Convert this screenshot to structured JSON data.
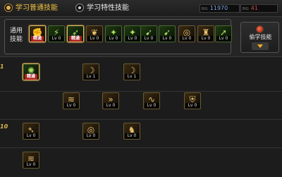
{
  "header": {
    "tab_normal": "学习普通技能",
    "tab_special": "学习特性技能",
    "currency_blue_tag": "BIG",
    "currency_blue": "11970",
    "currency_red_tag": "BIG",
    "currency_red": "41",
    "accent": "#f0c040"
  },
  "topbar": {
    "common_label": "通用技能",
    "learn_button": "偷学技能",
    "skills": [
      {
        "icon": "fist-icon",
        "label": "精通",
        "mastered": true
      },
      {
        "icon": "kick-icon",
        "label": "Lv 0",
        "mastered": false
      },
      {
        "icon": "runner-icon",
        "label": "精通",
        "mastered": true
      },
      {
        "icon": "wings-icon",
        "label": "Lv 0",
        "mastered": false
      },
      {
        "icon": "sparkle-icon",
        "label": "Lv 0",
        "mastered": false
      },
      {
        "icon": "sparkle-icon",
        "label": "Lv 0",
        "mastered": false
      },
      {
        "icon": "dash-icon",
        "label": "Lv 0",
        "mastered": false
      },
      {
        "icon": "dash-icon",
        "label": "Lv 0",
        "mastered": false
      },
      {
        "icon": "ring-icon",
        "label": "Lv 0",
        "mastered": false
      },
      {
        "icon": "warrior-icon",
        "label": "Lv 0",
        "mastered": false
      },
      {
        "icon": "leap-icon",
        "label": "Lv 0",
        "mastered": false
      }
    ]
  },
  "tree": {
    "rows": [
      {
        "level": "1"
      },
      {
        "level": "10"
      }
    ],
    "skills": [
      {
        "icon": "burst-icon",
        "label": "精通",
        "mastered": true
      },
      {
        "icon": "slash-icon",
        "label": "Lv 1",
        "mastered": false
      },
      {
        "icon": "slash-icon",
        "label": "Lv 1",
        "mastered": false
      },
      {
        "icon": "claw-icon",
        "label": "Lv 0",
        "mastered": false
      },
      {
        "icon": "arrows-icon",
        "label": "Lv 0",
        "mastered": false
      },
      {
        "icon": "sword-icon",
        "label": "Lv 0",
        "mastered": false
      },
      {
        "icon": "wave-icon",
        "label": "Lv 0",
        "mastered": false
      },
      {
        "icon": "shield-icon",
        "label": "Lv 0",
        "mastered": false
      },
      {
        "icon": "bird-icon",
        "label": "Lv 0",
        "mastered": false
      },
      {
        "icon": "ring-icon",
        "label": "Lv 0",
        "mastered": false
      },
      {
        "icon": "beast-icon",
        "label": "Lv 0",
        "mastered": false
      },
      {
        "icon": "claw-icon",
        "label": "Lv 0",
        "mastered": false
      }
    ]
  }
}
